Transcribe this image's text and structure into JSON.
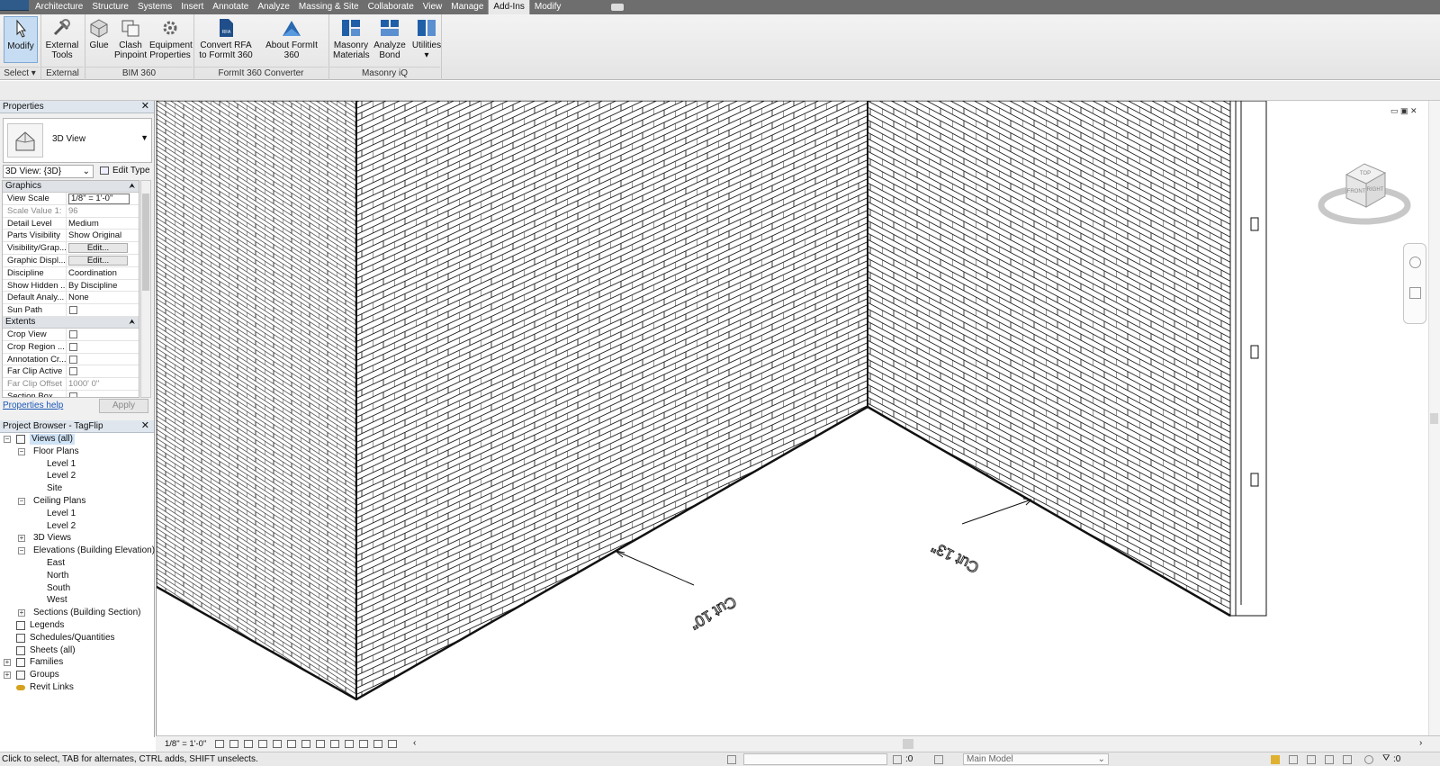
{
  "ribbon": {
    "tabs": [
      "Architecture",
      "Structure",
      "Systems",
      "Insert",
      "Annotate",
      "Analyze",
      "Massing & Site",
      "Collaborate",
      "View",
      "Manage",
      "Add-Ins",
      "Modify"
    ],
    "active_tab": "Add-Ins",
    "modify_label": "Modify",
    "select_label": "Select",
    "buttons": {
      "external_tools": [
        "External",
        "Tools"
      ],
      "glue": "Glue",
      "clash_pinpoint": [
        "Clash",
        "Pinpoint"
      ],
      "equipment_properties": [
        "Equipment",
        "Properties"
      ],
      "convert_rfa": [
        "Convert RFA",
        "to FormIt 360"
      ],
      "about_formit": "About FormIt 360",
      "masonry_materials": [
        "Masonry",
        "Materials"
      ],
      "analyze_bond": [
        "Analyze",
        "Bond"
      ],
      "utilities": "Utilities"
    },
    "groups": {
      "select": "Select",
      "external": "External",
      "bim360": "BIM 360",
      "formit": "FormIt 360 Converter",
      "masonry": "Masonry iQ"
    }
  },
  "properties": {
    "title": "Properties",
    "type_name": "3D View",
    "instance": "3D View: {3D}",
    "edit_type": "Edit Type",
    "categories": {
      "graphics": "Graphics",
      "extents": "Extents"
    },
    "rows": {
      "view_scale": {
        "name": "View Scale",
        "value": "1/8\" = 1'-0\""
      },
      "scale_value": {
        "name": "Scale Value    1:",
        "value": "96"
      },
      "detail_level": {
        "name": "Detail Level",
        "value": "Medium"
      },
      "parts_visibility": {
        "name": "Parts Visibility",
        "value": "Show Original"
      },
      "visibility_graphics": {
        "name": "Visibility/Grap...",
        "value": "Edit..."
      },
      "graphic_display": {
        "name": "Graphic Displ...",
        "value": "Edit..."
      },
      "discipline": {
        "name": "Discipline",
        "value": "Coordination"
      },
      "show_hidden": {
        "name": "Show Hidden ...",
        "value": "By Discipline"
      },
      "default_analysis": {
        "name": "Default Analy...",
        "value": "None"
      },
      "sun_path": {
        "name": "Sun Path"
      },
      "crop_view": {
        "name": "Crop View"
      },
      "crop_region": {
        "name": "Crop Region ..."
      },
      "annotation_crop": {
        "name": "Annotation Cr..."
      },
      "far_clip_active": {
        "name": "Far Clip Active"
      },
      "far_clip_offset": {
        "name": "Far Clip Offset",
        "value": "1000'  0\""
      },
      "section_box": {
        "name": "Section Box"
      }
    },
    "help_link": "Properties help",
    "apply": "Apply"
  },
  "browser": {
    "title": "Project Browser - TagFlip",
    "views_all": "Views (all)",
    "floor_plans": "Floor Plans",
    "fp_items": [
      "Level 1",
      "Level 2",
      "Site"
    ],
    "ceiling_plans": "Ceiling Plans",
    "cp_items": [
      "Level 1",
      "Level 2"
    ],
    "views_3d": "3D Views",
    "elevations": "Elevations (Building Elevation)",
    "elev_items": [
      "East",
      "North",
      "South",
      "West"
    ],
    "sections": "Sections (Building Section)",
    "legends": "Legends",
    "schedules": "Schedules/Quantities",
    "sheets": "Sheets (all)",
    "families": "Families",
    "groups": "Groups",
    "revit_links": "Revit Links"
  },
  "canvas": {
    "cut_label_left": "Cut 10\"",
    "cut_label_right": "Cut 13\""
  },
  "viewcube": {
    "top": "TOP",
    "front": "FRONT",
    "right": "RIGHT"
  },
  "viewbar": {
    "scale": "1/8\" = 1'-0\""
  },
  "status": {
    "hint": "Click to select, TAB for alternates, CTRL adds, SHIFT unselects.",
    "zero": ":0",
    "model": "Main Model",
    "filter_count": ":0"
  }
}
